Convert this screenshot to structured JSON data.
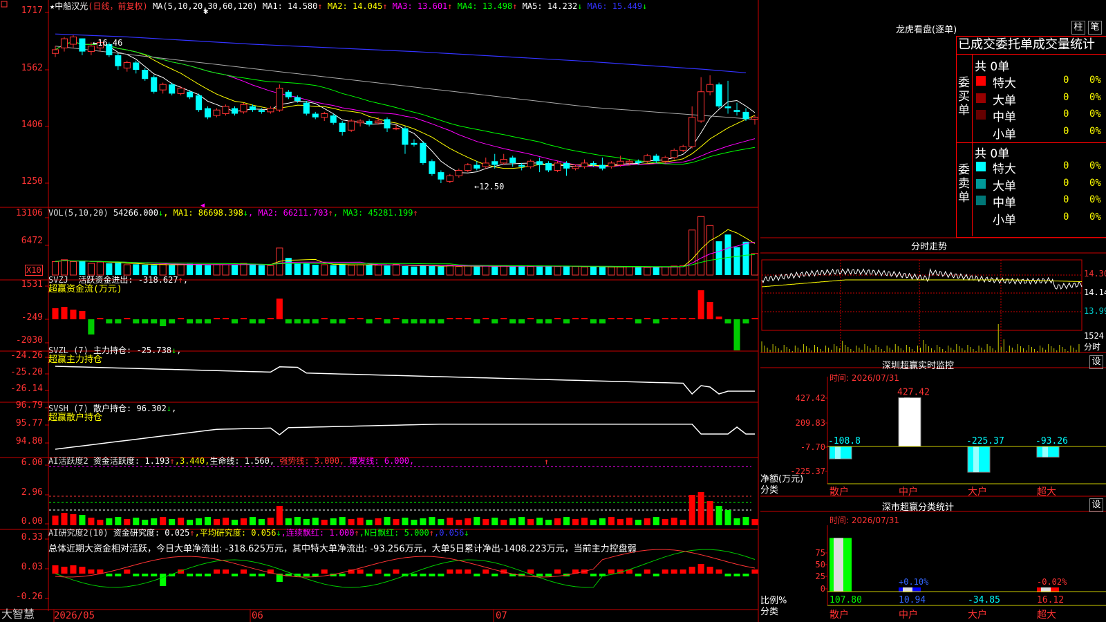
{
  "main": {
    "title": {
      "star": "★",
      "stock": "中船汉光",
      "period": "(日线，前复权)",
      "ma_def": "MA(5,10,20,30,60,120)",
      "mas": [
        {
          "label": "MA1: 14.580",
          "arrow": "↑",
          "color": "#ffffff"
        },
        {
          "label": "MA2: 14.045",
          "arrow": "↑",
          "color": "#ffff00"
        },
        {
          "label": "MA3: 13.601",
          "arrow": "↑",
          "color": "#ff00ff"
        },
        {
          "label": "MA4: 13.498",
          "arrow": "↑",
          "color": "#00ff00"
        },
        {
          "label": "MA5: 14.232",
          "arrow": "↓",
          "color": "#ffffff"
        },
        {
          "label": "MA6: 15.449",
          "arrow": "↓",
          "color": "#3333ff"
        }
      ]
    },
    "price_axis": [
      "1717",
      "1562",
      "1406",
      "1250"
    ],
    "price_marks": {
      "high": "16.46",
      "low": "12.50"
    },
    "vol": {
      "def": "VOL(5,10,20)",
      "value": "54266.000",
      "arrow": "↓",
      "mas": [
        {
          "label": "MA1: 86698.398",
          "arrow": "↓",
          "color": "#ffff00"
        },
        {
          "label": "MA2: 66211.703",
          "arrow": "↑",
          "color": "#ff00ff"
        },
        {
          "label": "MA3: 45281.199",
          "arrow": "↑",
          "color": "#00ff00"
        }
      ],
      "axis": [
        "13106",
        "6472"
      ],
      "unit": "X10"
    },
    "svzj": {
      "def": "SVZJ",
      "label": "活跃资金进出: -318.627",
      "arrow": "↑",
      "sub": "超赢资金流(万元)",
      "axis": [
        "1531",
        "-249",
        "-2030"
      ]
    },
    "svzl": {
      "def": "SVZL (7)",
      "label": "主力持仓: -25.738",
      "arrow": "↓",
      "suffix": ",",
      "sub": "超赢主力持仓",
      "axis": [
        "-24.26",
        "-25.20",
        "-26.14"
      ]
    },
    "svsh": {
      "def": "SVSH (7)",
      "label": "散户持仓: 96.302",
      "arrow": "↓",
      "suffix": ",",
      "sub": "超赢散户持仓",
      "axis": [
        "96.79",
        "95.77",
        "94.80"
      ]
    },
    "ai1": {
      "def": "AI活跃度2",
      "text1": "资金活跃度: 1.193",
      "a1": "↑",
      "v2": ",3.440,",
      "text3": "生命线: 1.560,",
      "strong": "强势线: 3.000,",
      "burst": "爆发线: 6.000,",
      "axis": [
        "6.00",
        "2.96",
        "0.00"
      ]
    },
    "ai2": {
      "def": "AI研究度2(10)",
      "text1": "资金研究度: 0.025",
      "a1": "↑",
      "avg": ",平均研究度: 0.056",
      "a2": "↓",
      "lian": ",连续飘红: 1.000",
      "a3": "↑",
      "nri": ",N日飘红: 5.000",
      "a4": "↑",
      "last": ",0.056",
      "a5": "↓",
      "summary": "总体近期大资金相对活跃，今日大单净流出: -318.625万元，其中特大单净流出: -93.256万元，大单5日累计净出-1408.223万元，当前主力控盘弱",
      "axis": [
        "0.33",
        "0.03",
        "-0.26"
      ]
    },
    "dates": [
      "2026/05",
      "06",
      "07"
    ],
    "brand": "大智慧"
  },
  "chart_data": [
    {
      "type": "candlestick",
      "title": "中船汉光(日线，前复权)",
      "ylim": [
        12.2,
        17.2
      ],
      "candles": [
        [
          16.05,
          16.15,
          16.25,
          15.95
        ],
        [
          16.2,
          16.45,
          16.5,
          16.1
        ],
        [
          16.3,
          16.5,
          16.55,
          16.2
        ],
        [
          16.46,
          16.1,
          16.46,
          16.0
        ],
        [
          16.1,
          16.25,
          16.35,
          16.0
        ],
        [
          16.2,
          16.35,
          16.45,
          16.1
        ],
        [
          16.3,
          16.0,
          16.35,
          15.95
        ],
        [
          16.0,
          15.7,
          16.05,
          15.6
        ],
        [
          15.65,
          15.8,
          15.85,
          15.55
        ],
        [
          15.8,
          15.6,
          15.85,
          15.5
        ],
        [
          15.6,
          15.35,
          15.65,
          15.3
        ],
        [
          15.4,
          15.0,
          15.45,
          14.95
        ],
        [
          15.05,
          15.2,
          15.25,
          14.95
        ],
        [
          15.2,
          14.95,
          15.25,
          14.9
        ],
        [
          14.95,
          15.1,
          15.15,
          14.9
        ],
        [
          15.0,
          14.85,
          15.05,
          14.8
        ],
        [
          14.9,
          14.5,
          14.95,
          14.45
        ],
        [
          14.55,
          14.3,
          14.6,
          14.25
        ],
        [
          14.35,
          14.5,
          14.55,
          14.3
        ],
        [
          14.4,
          14.6,
          14.65,
          14.35
        ],
        [
          14.55,
          14.4,
          14.6,
          14.35
        ],
        [
          14.45,
          14.65,
          14.7,
          14.4
        ],
        [
          14.6,
          14.5,
          14.65,
          14.45
        ],
        [
          14.5,
          14.45,
          14.55,
          14.4
        ],
        [
          14.45,
          14.55,
          14.6,
          14.4
        ],
        [
          14.5,
          15.1,
          15.2,
          14.45
        ],
        [
          15.0,
          14.85,
          15.05,
          14.8
        ],
        [
          14.85,
          14.75,
          14.9,
          14.7
        ],
        [
          14.7,
          14.4,
          14.75,
          14.35
        ],
        [
          14.4,
          14.3,
          14.45,
          14.25
        ],
        [
          14.3,
          14.4,
          14.45,
          14.2
        ],
        [
          14.35,
          14.15,
          14.4,
          14.1
        ],
        [
          14.15,
          13.9,
          14.2,
          13.8
        ],
        [
          13.95,
          14.2,
          14.25,
          13.9
        ],
        [
          14.15,
          14.2,
          14.25,
          14.05
        ],
        [
          14.2,
          14.1,
          14.25,
          14.05
        ],
        [
          14.15,
          14.2,
          14.3,
          14.1
        ],
        [
          14.25,
          14.0,
          14.3,
          13.9
        ],
        [
          14.0,
          14.0,
          14.1,
          13.95
        ],
        [
          14.0,
          13.55,
          14.05,
          13.3
        ],
        [
          13.6,
          13.55,
          13.7,
          13.5
        ],
        [
          13.6,
          13.05,
          13.65,
          13.0
        ],
        [
          13.1,
          12.75,
          13.15,
          12.7
        ],
        [
          12.8,
          12.6,
          12.85,
          12.5
        ],
        [
          12.55,
          12.7,
          12.75,
          12.5
        ],
        [
          12.7,
          12.85,
          12.9,
          12.65
        ],
        [
          12.85,
          13.0,
          13.05,
          12.8
        ],
        [
          13.0,
          12.9,
          13.1,
          12.85
        ],
        [
          12.95,
          13.05,
          13.2,
          12.9
        ],
        [
          13.1,
          13.0,
          13.3,
          12.9
        ],
        [
          13.05,
          13.15,
          13.3,
          13.0
        ],
        [
          13.2,
          13.05,
          13.25,
          12.95
        ],
        [
          13.0,
          12.95,
          13.05,
          12.85
        ],
        [
          12.95,
          13.1,
          13.15,
          12.9
        ],
        [
          13.1,
          13.0,
          13.2,
          12.8
        ],
        [
          13.05,
          12.85,
          13.1,
          12.8
        ],
        [
          12.85,
          13.05,
          13.1,
          12.8
        ],
        [
          13.05,
          12.9,
          13.1,
          12.7
        ],
        [
          12.9,
          12.95,
          13.0,
          12.85
        ],
        [
          12.95,
          13.05,
          13.15,
          12.9
        ],
        [
          13.05,
          13.0,
          13.1,
          12.95
        ],
        [
          13.0,
          12.9,
          13.2,
          12.85
        ],
        [
          12.95,
          13.05,
          13.1,
          12.9
        ],
        [
          13.0,
          13.1,
          13.25,
          12.95
        ],
        [
          13.05,
          13.1,
          13.15,
          13.0
        ],
        [
          13.1,
          13.05,
          13.15,
          13.0
        ],
        [
          13.1,
          13.25,
          13.3,
          13.05
        ],
        [
          13.25,
          13.1,
          13.3,
          13.05
        ],
        [
          13.1,
          13.2,
          13.25,
          13.05
        ],
        [
          13.2,
          13.4,
          13.45,
          13.15
        ],
        [
          13.4,
          13.5,
          13.55,
          13.35
        ],
        [
          13.5,
          14.3,
          14.6,
          13.45
        ],
        [
          14.2,
          15.0,
          15.4,
          14.15
        ],
        [
          15.0,
          15.2,
          15.45,
          14.9
        ],
        [
          15.2,
          14.6,
          15.25,
          14.55
        ],
        [
          14.6,
          14.55,
          15.3,
          14.4
        ],
        [
          14.5,
          14.45,
          14.7,
          14.35
        ],
        [
          14.45,
          14.25,
          14.55,
          14.2
        ],
        [
          14.25,
          14.3,
          14.35,
          14.1
        ]
      ]
    },
    {
      "type": "line",
      "title": "MA",
      "series": [
        {
          "name": "MA1",
          "values": []
        },
        {
          "name": "MA6",
          "points": [
            [
              0,
              16.58
            ],
            [
              8,
              16.5
            ],
            [
              22,
              16.3
            ],
            [
              40,
              16.1
            ],
            [
              58,
              15.85
            ],
            [
              72,
              15.62
            ],
            [
              77,
              15.52
            ]
          ]
        }
      ]
    },
    {
      "type": "bar",
      "title": "VOL(5,10,20)",
      "ylim": [
        0,
        14000
      ],
      "values": [
        3000,
        3400,
        3000,
        3200,
        2600,
        2900,
        2600,
        2700,
        2300,
        2400,
        2300,
        2200,
        2400,
        2200,
        2400,
        2500,
        2300,
        2200,
        2300,
        2300,
        2300,
        2600,
        2400,
        2200,
        2100,
        6000,
        3800,
        2600,
        2600,
        2300,
        2300,
        2200,
        2400,
        2200,
        2300,
        2300,
        2200,
        2100,
        2400,
        2000,
        1900,
        2100,
        2000,
        1900,
        2200,
        1900,
        2000,
        1900,
        2000,
        1900,
        2100,
        1900,
        2000,
        1900,
        2100,
        2000,
        1900,
        2000,
        1900,
        1800,
        1900,
        1800,
        1800,
        1800,
        1900,
        1700,
        1700,
        1700,
        1800,
        2000,
        2100,
        10000,
        13000,
        11000,
        7500,
        9000,
        6200,
        7400,
        4800
      ]
    }
  ],
  "right": {
    "longhu": "龙虎看盘(逐单)",
    "btn_bar": "柱",
    "btn_bi": "笔",
    "tabs": "已成交委托单成交量统计",
    "buy": {
      "side": "委买单",
      "total": "共 0单",
      "rows": [
        {
          "name": "特大",
          "num": "0",
          "pct": "0%",
          "color": "#ff0000"
        },
        {
          "name": "大单",
          "num": "0",
          "pct": "0%",
          "color": "#990000"
        },
        {
          "name": "中单",
          "num": "0",
          "pct": "0%",
          "color": "#660000"
        },
        {
          "name": "小单",
          "num": "0",
          "pct": "0%",
          "color": ""
        }
      ]
    },
    "sell": {
      "side": "委卖单",
      "total": "共 0单",
      "rows": [
        {
          "name": "特大",
          "num": "0",
          "pct": "0%",
          "color": "#00ffff"
        },
        {
          "name": "大单",
          "num": "0",
          "pct": "0%",
          "color": "#009999"
        },
        {
          "name": "中单",
          "num": "0",
          "pct": "0%",
          "color": "#007777"
        },
        {
          "name": "小单",
          "num": "0",
          "pct": "0%",
          "color": ""
        }
      ]
    },
    "fenshi": {
      "title": "分时走势",
      "axis": [
        "14.30",
        "14.14",
        "13.99"
      ],
      "vol": "1524",
      "vol_unit": "分时"
    },
    "sz": {
      "title": "深圳超赢实时监控",
      "time": "时间: 2026/07/31",
      "btn": "设",
      "axis": [
        "427.42",
        "209.83",
        "-7.70",
        "-225.37"
      ],
      "ylabel": "净额(万元)",
      "xlabel": "分类",
      "cats": [
        "散户",
        "中户",
        "大户",
        "超大"
      ],
      "values": [
        -108.8,
        427.42,
        -225.37,
        -93.26
      ],
      "vlabels": [
        "-108.8",
        "427.42",
        "-225.37",
        "-93.26"
      ]
    },
    "szc": {
      "title": "深市超赢分类统计",
      "time": "时间: 2026/07/31",
      "btn": "设",
      "axis": [
        "75",
        "50",
        "25",
        "0"
      ],
      "ylabel": "比例%",
      "xlabel": "分类",
      "cats": [
        "散户",
        "中户",
        "大户",
        "超大"
      ],
      "values": [
        107.8,
        10.94,
        -34.85,
        16.12
      ],
      "vlabels": [
        "107.80",
        "10.94",
        "-34.85",
        "16.12"
      ],
      "top_labels": [
        "",
        "+0.10%",
        "",
        "-0.02%"
      ]
    }
  }
}
